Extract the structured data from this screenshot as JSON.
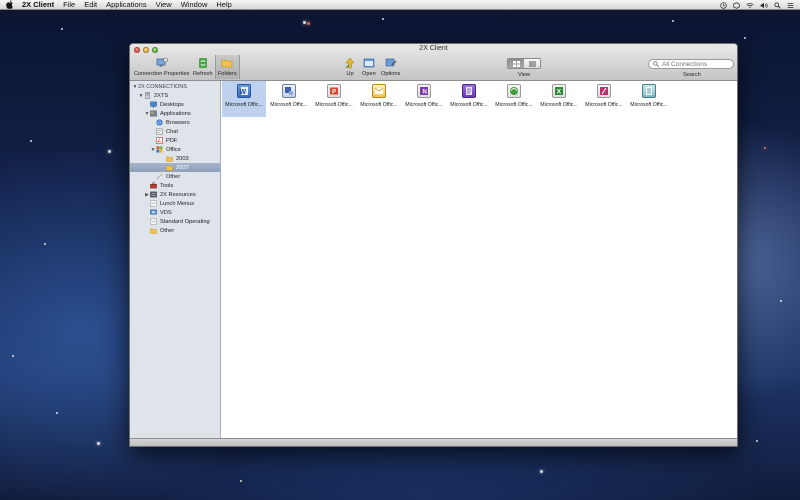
{
  "menubar": {
    "app_name": "2X Client",
    "menus": [
      "File",
      "Edit",
      "Applications",
      "View",
      "Window",
      "Help"
    ]
  },
  "window": {
    "title": "2X Client",
    "toolbar": {
      "connection_properties": "Connection Properties",
      "refresh": "Refresh",
      "folders": "Folders",
      "up": "Up",
      "open": "Open",
      "options": "Options",
      "view": "View",
      "search_label": "Search",
      "search_placeholder": "All Connections"
    },
    "sidebar": {
      "header": "2X CONNECTIONS",
      "items": [
        {
          "label": "2XTS",
          "expanded": true
        },
        {
          "label": "Desktops"
        },
        {
          "label": "Applications",
          "expanded": true
        },
        {
          "label": "Browsers"
        },
        {
          "label": "Chat"
        },
        {
          "label": "PDF"
        },
        {
          "label": "Office",
          "expanded": true
        },
        {
          "label": "2003"
        },
        {
          "label": "2007",
          "selected": true
        },
        {
          "label": "Other"
        },
        {
          "label": "Tools"
        },
        {
          "label": "2X Resources",
          "expanded": false
        },
        {
          "label": "Lunch Menus"
        },
        {
          "label": "VDS"
        },
        {
          "label": "Standard Operating"
        },
        {
          "label": "Other"
        }
      ]
    },
    "content": {
      "items": [
        {
          "label": "Microsoft Offic...",
          "color": "#3a6ec8",
          "selected": true
        },
        {
          "label": "Microsoft Offic...",
          "color": "#3a5fb0"
        },
        {
          "label": "Microsoft Offic...",
          "color": "#d5462a"
        },
        {
          "label": "Microsoft Offic...",
          "color": "#e8a61c"
        },
        {
          "label": "Microsoft Offic...",
          "color": "#7c3aa8"
        },
        {
          "label": "Microsoft Offic...",
          "color": "#6a3cb4"
        },
        {
          "label": "Microsoft Offic...",
          "color": "#3e9a3a"
        },
        {
          "label": "Microsoft Offic...",
          "color": "#2f8a3c"
        },
        {
          "label": "Microsoft Offic...",
          "color": "#b8326e"
        },
        {
          "label": "Microsoft Offic...",
          "color": "#2a7f8a"
        }
      ]
    }
  }
}
